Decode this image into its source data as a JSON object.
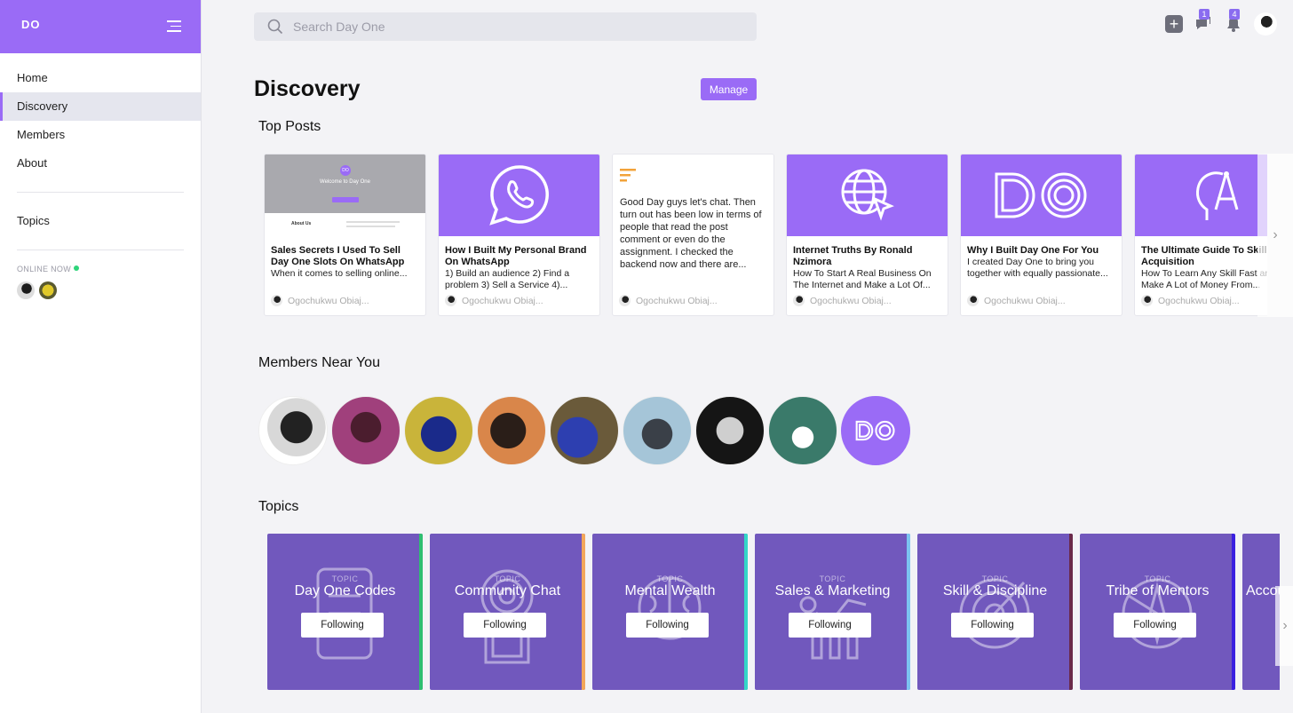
{
  "sidebar": {
    "logo": "DO",
    "nav": [
      "Home",
      "Discovery",
      "Members",
      "About"
    ],
    "topics_label": "Topics",
    "online_label": "ONLINE NOW"
  },
  "topbar": {
    "search_placeholder": "Search Day One",
    "chat_badge": "1",
    "notif_badge": "4"
  },
  "main": {
    "title": "Discovery",
    "manage_label": "Manage",
    "top_posts_title": "Top Posts",
    "members_title": "Members Near You",
    "topics_title": "Topics",
    "posts": [
      {
        "title": "Sales Secrets I Used To Sell Day One Slots On WhatsApp",
        "excerpt": "When it comes to selling online...",
        "author": "Ogochukwu Obiaj...",
        "thumb_title": "Welcome to Day One",
        "thumb_section": "About Us"
      },
      {
        "title": "How I Built My Personal Brand On WhatsApp",
        "excerpt": "1) Build an audience 2) Find a problem 3) Sell a Service 4)...",
        "author": "Ogochukwu Obiaj..."
      },
      {
        "body": "Good Day guys let's chat. Then turn out has been low in terms of people that read the post comment or even do the assignment. I checked the backend now and there are...",
        "author": "Ogochukwu Obiaj..."
      },
      {
        "title": "Internet Truths By Ronald Nzimora",
        "excerpt": "How To Start A Real Business On The Internet and Make a Lot Of...",
        "author": "Ogochukwu Obiaj..."
      },
      {
        "title": "Why I Built Day One For You",
        "excerpt": "I created Day One to bring you together with equally passionate...",
        "author": "Ogochukwu Obiaj..."
      },
      {
        "title": "The Ultimate Guide To Skill Acquisition",
        "excerpt": "How To Learn Any Skill Fast and Make A Lot of Money From...",
        "author": "Ogochukwu Obiaj..."
      }
    ],
    "topic_kind": "TOPIC",
    "topics": [
      {
        "name": "Day One Codes",
        "button": "Following",
        "stripe": "#2fbf71"
      },
      {
        "name": "Community Chat",
        "button": "Following",
        "stripe": "#f2a65a"
      },
      {
        "name": "Mental Wealth",
        "button": "Following",
        "stripe": "#33d6c8"
      },
      {
        "name": "Sales & Marketing",
        "button": "Following",
        "stripe": "#7cc3f0"
      },
      {
        "name": "Skill & Discipline",
        "button": "Following",
        "stripe": "#6b2a4a"
      },
      {
        "name": "Tribe of Mentors",
        "button": "Following",
        "stripe": "#3a1fe0"
      },
      {
        "name": "Accou",
        "button": "",
        "stripe": "#9a6bf6"
      }
    ],
    "colors": {
      "accent": "#9a6bf6",
      "topic_bg": "#7158bd"
    }
  }
}
